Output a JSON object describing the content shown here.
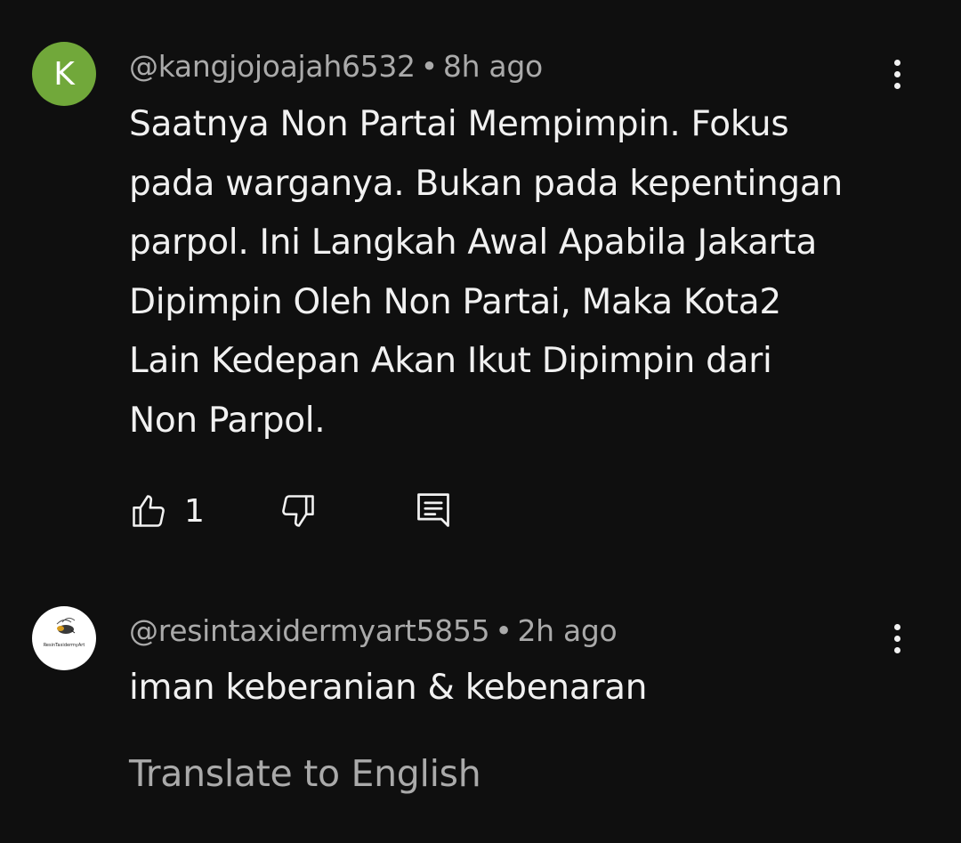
{
  "comments": [
    {
      "avatar_letter": "K",
      "handle": "@kangjojoajah6532",
      "separator": "•",
      "time": "8h ago",
      "text_lines": [
        "Saatnya Non Partai Mempimpin. Fokus",
        "pada warganya. Bukan pada kepentingan",
        "parpol. Ini Langkah Awal Apabila Jakarta",
        "Dipimpin Oleh Non Partai, Maka Kota2",
        "Lain Kedepan Akan Ikut Dipimpin dari",
        "Non Parpol."
      ],
      "like_count": "1"
    },
    {
      "avatar_logo_text": "ResinTaxidermyArt",
      "handle": "@resintaxidermyart5855",
      "separator": "•",
      "time": "2h ago",
      "text": "iman keberanian & kebenaran",
      "translate_label": "Translate to English"
    }
  ],
  "icons": {
    "menu": "more-vertical-icon",
    "like": "thumbs-up-icon",
    "dislike": "thumbs-down-icon",
    "reply": "reply-comment-icon"
  },
  "colors": {
    "background": "#0f0f0f",
    "text": "#f1f1f1",
    "secondary_text": "#aaaaaa",
    "avatar_green": "#71a83a"
  }
}
